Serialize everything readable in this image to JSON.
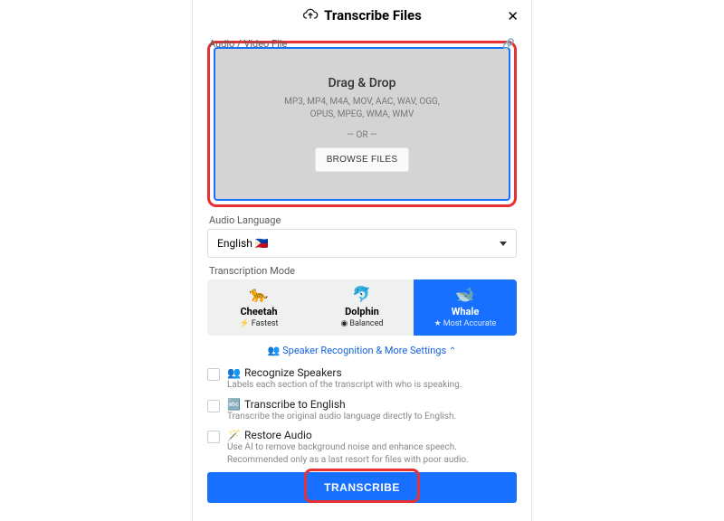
{
  "header": {
    "title": "Transcribe Files"
  },
  "fileField": {
    "label": "Audio / Video File",
    "linkIconName": "link-icon"
  },
  "dropzone": {
    "title": "Drag & Drop",
    "formatsLine1": "MP3, MP4, M4A, MOV, AAC, WAV, OGG,",
    "formatsLine2": "OPUS, MPEG, WMA, WMV",
    "orLabel": "— OR —",
    "browseLabel": "BROWSE FILES"
  },
  "languageField": {
    "label": "Audio Language",
    "value": "English",
    "flag": "🇵🇭"
  },
  "modeField": {
    "label": "Transcription Mode",
    "modes": [
      {
        "emoji": "🐆",
        "name": "Cheetah",
        "subIcon": "⚡",
        "sub": "Fastest",
        "selected": false
      },
      {
        "emoji": "🐬",
        "name": "Dolphin",
        "subIcon": "◉",
        "sub": "Balanced",
        "selected": false
      },
      {
        "emoji": "🐋",
        "name": "Whale",
        "subIcon": "★",
        "sub": "Most Accurate",
        "selected": true
      }
    ]
  },
  "moreSettings": {
    "label": "Speaker Recognition & More Settings",
    "emoji": "👥",
    "expanded": true
  },
  "options": [
    {
      "emoji": "👥",
      "title": "Recognize Speakers",
      "desc": "Labels each section of the transcript with who is speaking.",
      "checked": false
    },
    {
      "emoji": "🔤",
      "title": "Transcribe to English",
      "desc": "Transcribe the original audio language directly to English.",
      "checked": false
    },
    {
      "emoji": "🪄",
      "title": "Restore Audio",
      "desc": "Use AI to remove background noise and enhance speech. Recommended only as a last resort for files with poor audio.",
      "checked": false
    }
  ],
  "submit": {
    "label": "TRANSCRIBE"
  },
  "colors": {
    "accent": "#1770ff",
    "highlight": "#e63232"
  }
}
